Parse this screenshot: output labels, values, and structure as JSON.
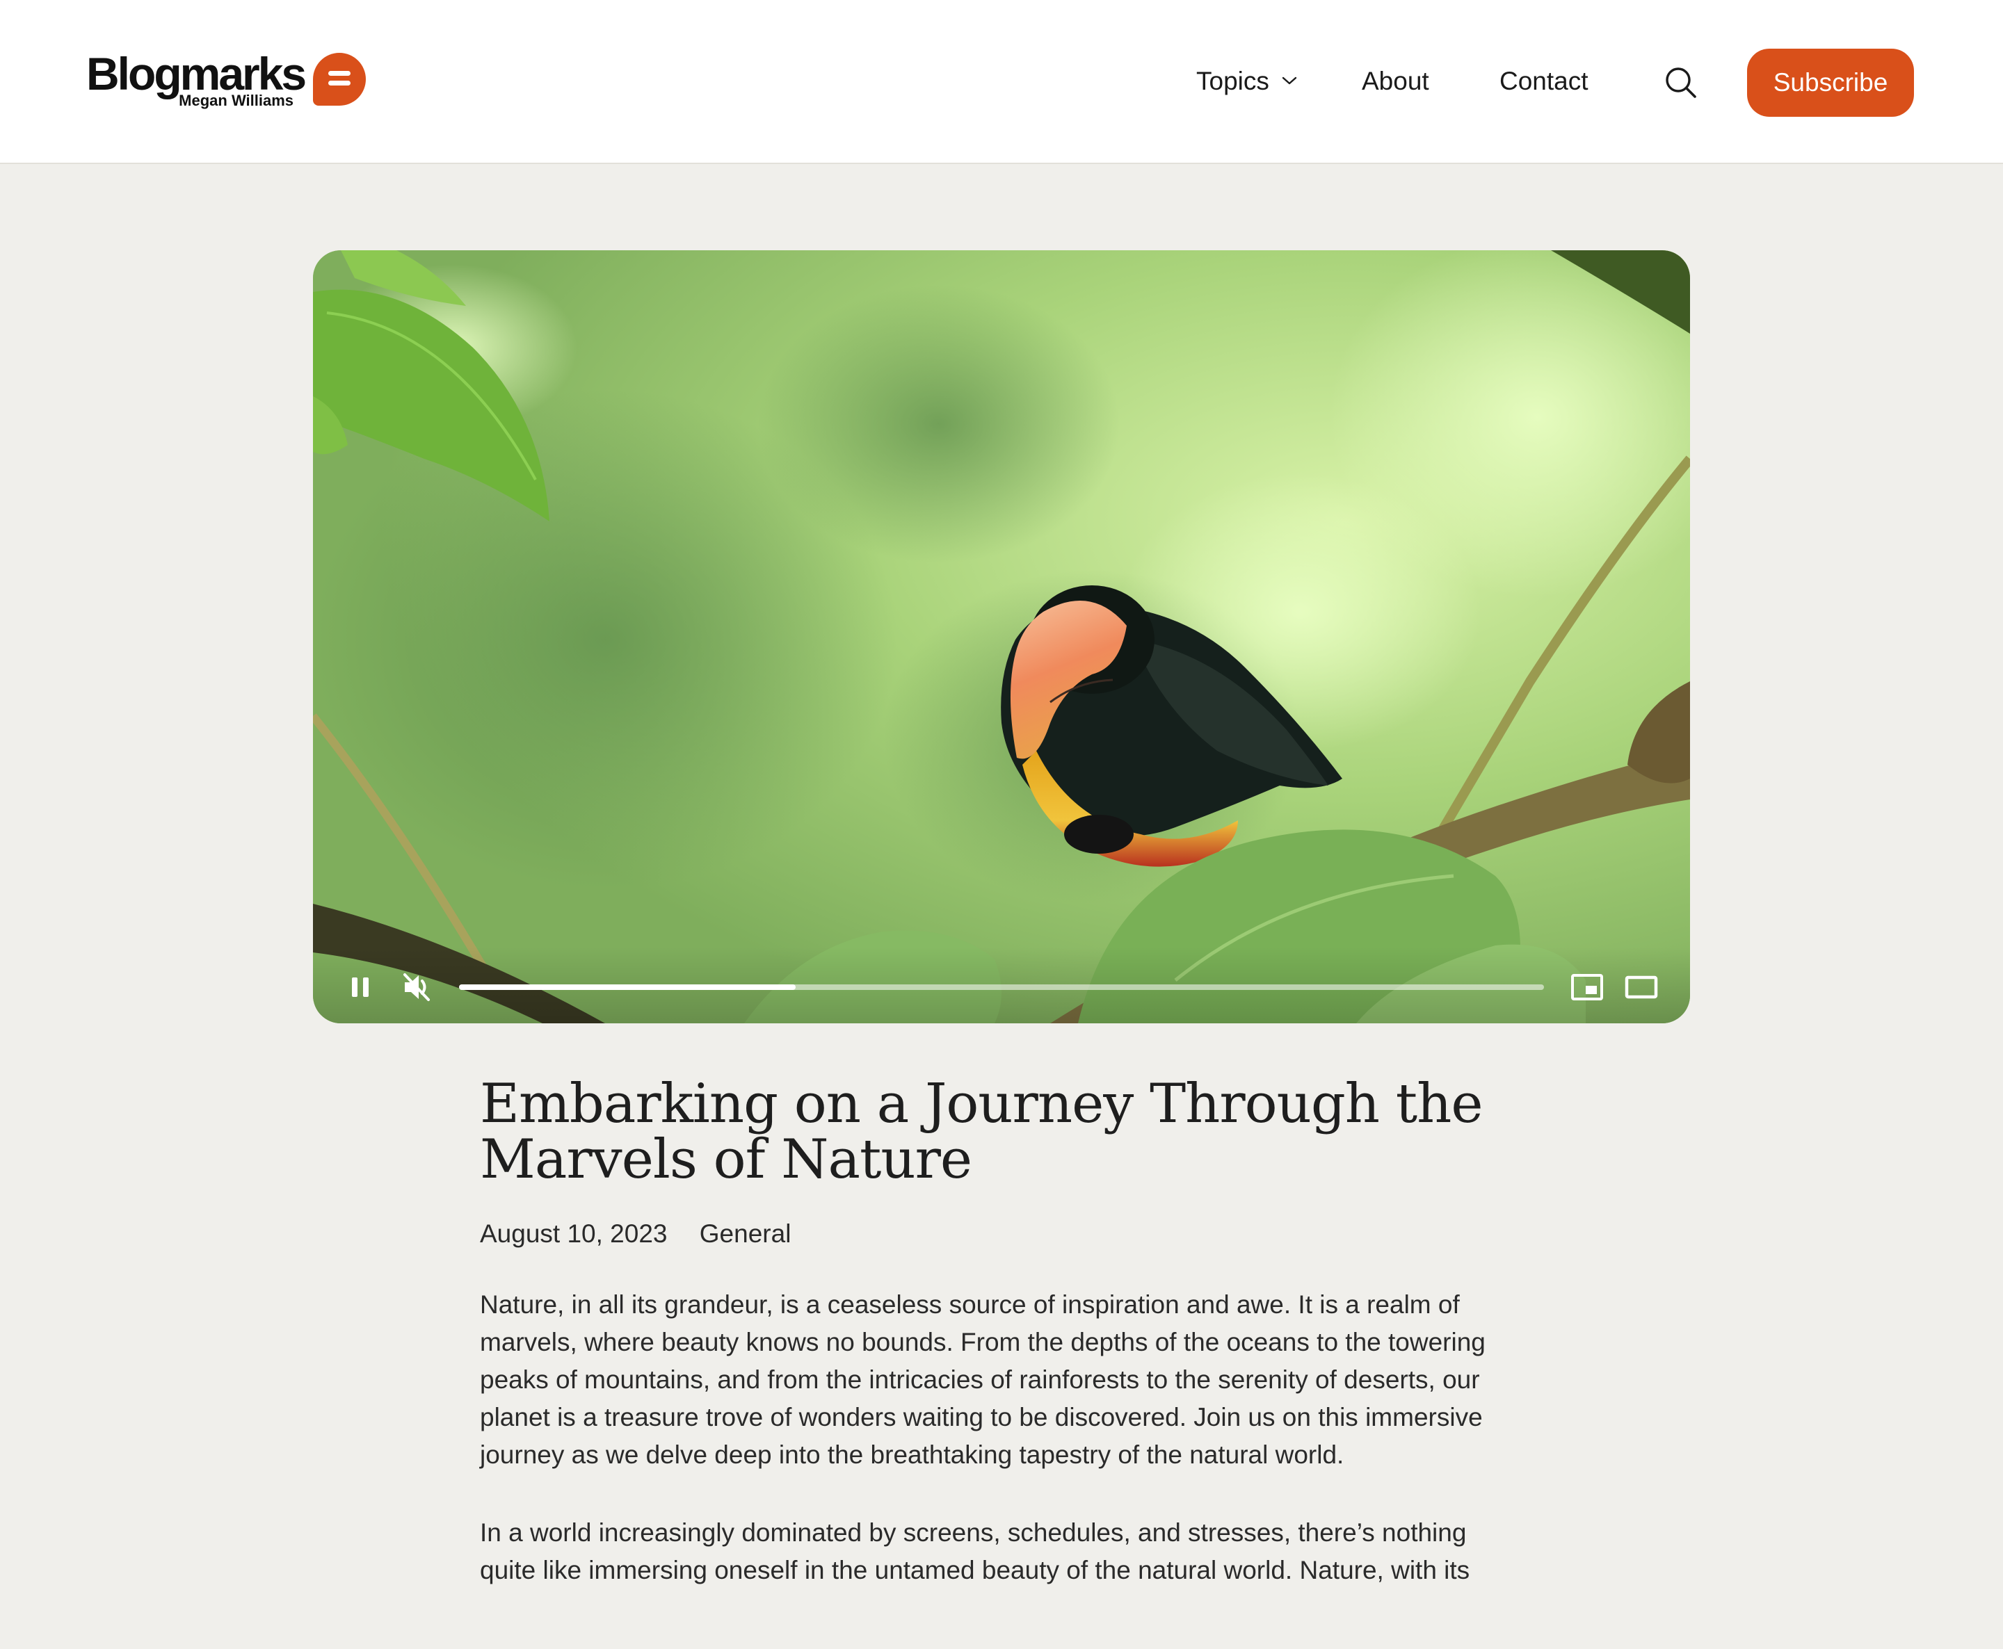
{
  "header": {
    "logo": {
      "wordmark": "Blogmarks",
      "author": "Megan Williams"
    },
    "nav": {
      "topics": "Topics",
      "about": "About",
      "contact": "Contact"
    },
    "search_icon": "search-icon",
    "subscribe_label": "Subscribe"
  },
  "video": {
    "state": "playing",
    "muted": true,
    "progress": 0.31,
    "icons": [
      "pause-icon",
      "muted-speaker-icon",
      "picture-in-picture-icon",
      "fullscreen-icon"
    ]
  },
  "article": {
    "title": "Embarking on a Journey Through the Marvels of Nature",
    "date": "August 10, 2023",
    "category": "General",
    "paragraphs": [
      "Nature, in all its grandeur, is a ceaseless source of inspiration and awe. It is a realm of marvels, where beauty knows no bounds. From the depths of the oceans to the towering peaks of mountains, and from the intricacies of rainforests to the serenity of deserts, our planet is a treasure trove of wonders waiting to be discovered. Join us on this immersive journey as we delve deep into the breathtaking tapestry of the natural world.",
      "In a world increasingly dominated by screens, schedules, and stresses, there’s nothing quite like immersing oneself in the untamed beauty of the natural world. Nature, with its"
    ]
  },
  "colors": {
    "accent": "#d9501a",
    "background": "#f0efeb",
    "header_bg": "#ffffff",
    "text": "#1f1f1f"
  }
}
